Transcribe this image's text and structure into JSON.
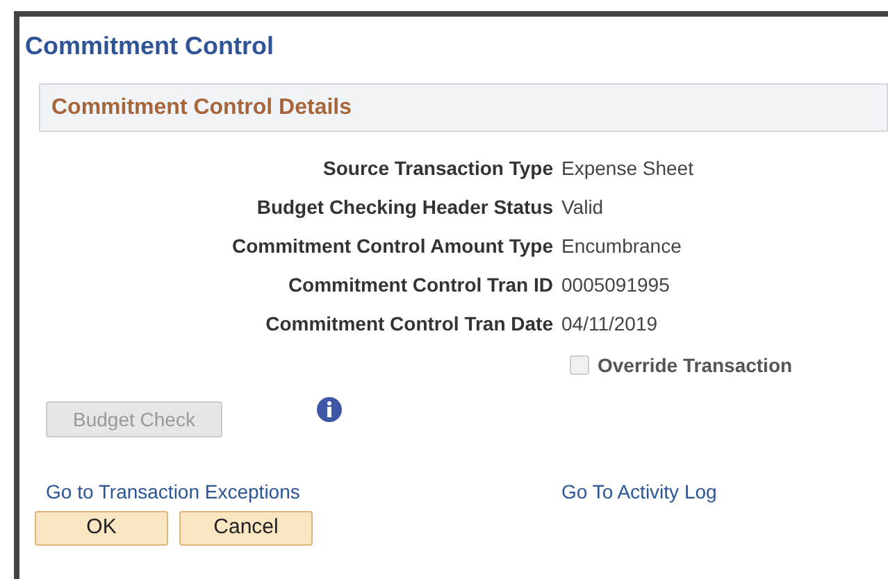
{
  "window": {
    "title": "Commitment Control"
  },
  "section": {
    "title": "Commitment Control Details"
  },
  "fields": [
    {
      "label": "Source Transaction Type",
      "value": "Expense Sheet"
    },
    {
      "label": "Budget Checking Header Status",
      "value": "Valid"
    },
    {
      "label": "Commitment Control Amount Type",
      "value": "Encumbrance"
    },
    {
      "label": "Commitment Control Tran ID",
      "value": "0005091995"
    },
    {
      "label": "Commitment Control Tran Date",
      "value": "04/11/2019"
    }
  ],
  "override": {
    "label": "Override Transaction",
    "checked": false,
    "disabled": true
  },
  "budget_check": {
    "label": "Budget Check",
    "disabled": true
  },
  "links": [
    "Go to Transaction Exceptions",
    "Go To Activity Log"
  ],
  "buttons": [
    "OK",
    "Cancel"
  ]
}
